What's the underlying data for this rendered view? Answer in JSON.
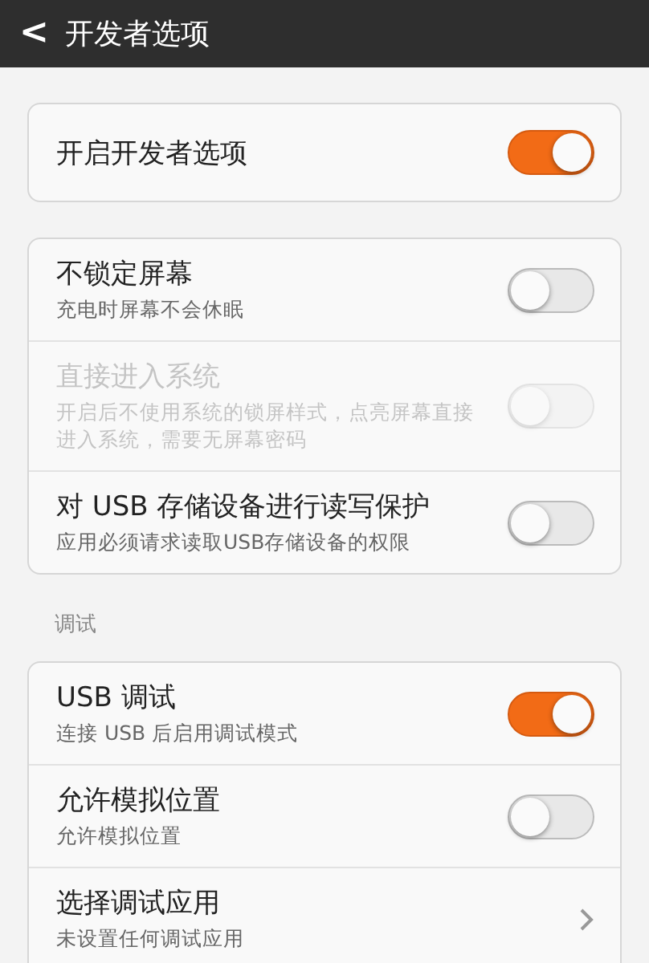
{
  "header": {
    "back": "<",
    "title": "开发者选项"
  },
  "groups": [
    {
      "rows": [
        {
          "kind": "toggle",
          "title": "开启开发者选项",
          "on": true,
          "disabled": false
        }
      ]
    },
    {
      "rows": [
        {
          "kind": "toggle",
          "title": "不锁定屏幕",
          "subtitle": "充电时屏幕不会休眠",
          "on": false,
          "disabled": false
        },
        {
          "kind": "toggle",
          "title": "直接进入系统",
          "subtitle": "开启后不使用系统的锁屏样式，点亮屏幕直接进入系统，需要无屏幕密码",
          "on": false,
          "disabled": true
        },
        {
          "kind": "toggle",
          "title": "对 USB 存储设备进行读写保护",
          "subtitle": "应用必须请求读取USB存储设备的权限",
          "on": false,
          "disabled": false
        }
      ]
    },
    {
      "label": "调试",
      "rows": [
        {
          "kind": "toggle",
          "title": "USB 调试",
          "subtitle": "连接 USB 后启用调试模式",
          "on": true,
          "disabled": false
        },
        {
          "kind": "toggle",
          "title": "允许模拟位置",
          "subtitle": "允许模拟位置",
          "on": false,
          "disabled": false
        },
        {
          "kind": "link",
          "title": "选择调试应用",
          "subtitle": "未设置任何调试应用"
        }
      ]
    }
  ]
}
